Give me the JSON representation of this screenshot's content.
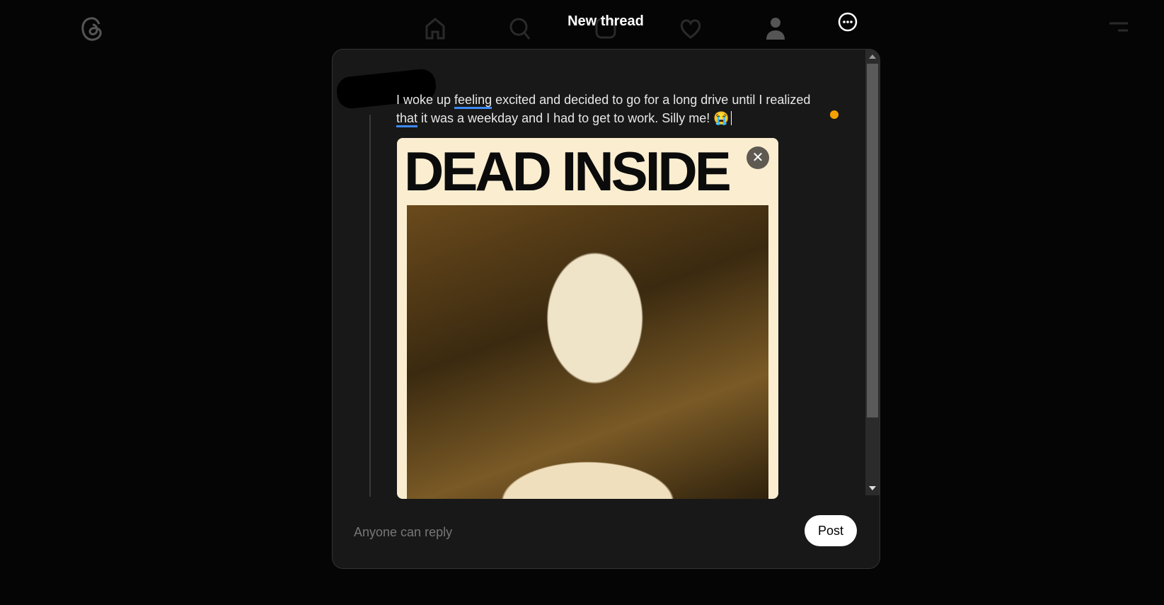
{
  "header": {
    "title": "New thread",
    "icons": [
      "threads-logo-icon",
      "home-icon",
      "search-icon",
      "create-icon",
      "heart-icon",
      "profile-icon",
      "more-icon",
      "menu-icon"
    ]
  },
  "composer": {
    "text_parts": [
      "I woke up ",
      "feeling",
      " excited and decided to go for a long drive until I realized ",
      "that",
      " it was a weekday and I had to get to work. Silly me! ",
      "😭"
    ],
    "media": {
      "title": "DEAD INSIDE",
      "close": "✕"
    },
    "reply_setting": "Anyone can reply",
    "post_label": "Post"
  },
  "colors": {
    "accent_underline": "#3d8af7",
    "status_dot": "#f5a000",
    "modal_bg": "#181818"
  }
}
